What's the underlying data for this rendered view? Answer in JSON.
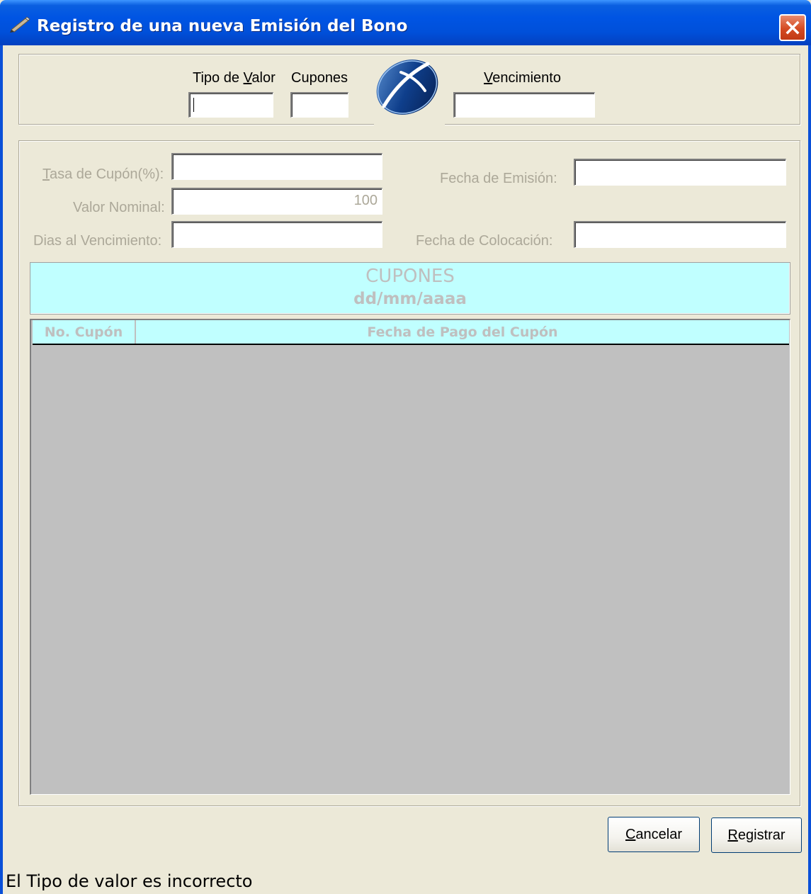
{
  "window": {
    "title": "Registro de una nueva Emisión del Bono",
    "title_color": "#0054E3",
    "close_color": "#D44A22"
  },
  "header": {
    "tipo_valor_label_pre": "Tipo de ",
    "tipo_valor_label_u": "V",
    "tipo_valor_label_post": "alor",
    "tipo_valor_value": "",
    "cupones_label": "Cupones",
    "cupones_value": "",
    "vencimiento_label_u": "V",
    "vencimiento_label_post": "encimiento",
    "vencimiento_value": "",
    "logo_icon": "company-logo-icon"
  },
  "form": {
    "tasa_label_u": "T",
    "tasa_label_post": "asa de Cupón(%):",
    "tasa_value": "",
    "valor_nominal_label": "Valor Nominal:",
    "valor_nominal_value": "100",
    "dias_label": "Dias al Vencimiento:",
    "dias_value": "",
    "fecha_emision_label": "Fecha de Emisión:",
    "fecha_emision_value": "",
    "fecha_colocacion_label": "Fecha de Colocación:",
    "fecha_colocacion_value": ""
  },
  "cupones_panel": {
    "title": "CUPONES",
    "subtitle": "dd/mm/aaaa",
    "bg_color": "#C0FFFF"
  },
  "grid": {
    "columns": [
      "No. Cupón",
      "Fecha de Pago del Cupón"
    ],
    "rows": [],
    "bg_color": "#C0C0C0"
  },
  "buttons": {
    "cancel_u": "C",
    "cancel_post": "ancelar",
    "register_u": "R",
    "register_post": "egistrar"
  },
  "status": {
    "message": "El Tipo de valor es incorrecto"
  }
}
